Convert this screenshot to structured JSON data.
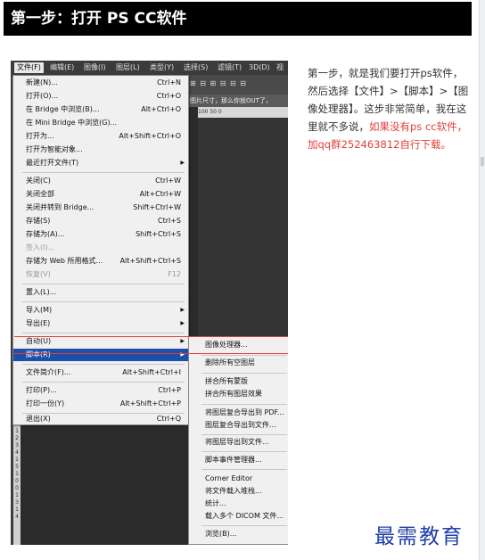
{
  "header": {
    "title": "第一步：打开 PS CC软件"
  },
  "screenshot": {
    "menubar": [
      "文件(F)",
      "编辑(E)",
      "图像(I)",
      "图层(L)",
      "类型(Y)",
      "选择(S)",
      "滤镜(T)",
      "3D(D)",
      "视"
    ],
    "toolbar_icons": "⊞ ⊟ ⊞  ⊟ ⊟ ⊟",
    "doc_title": "图片尺寸，那么你就OUT了，",
    "ruler_top": "100   50    0",
    "ruler_left": "0 1 2 3 4 1 5 1 0 0 1 3 1 4",
    "file_menu": [
      {
        "label": "新建(N)...",
        "shortcut": "Ctrl+N"
      },
      {
        "label": "打开(O)...",
        "shortcut": "Ctrl+O"
      },
      {
        "label": "在 Bridge 中浏览(B)...",
        "shortcut": "Alt+Ctrl+O"
      },
      {
        "label": "在 Mini Bridge 中浏览(G)...",
        "shortcut": ""
      },
      {
        "label": "打开为...",
        "shortcut": "Alt+Shift+Ctrl+O"
      },
      {
        "label": "打开为智能对象...",
        "shortcut": ""
      },
      {
        "label": "最近打开文件(T)",
        "shortcut": ""
      },
      {
        "label": "关闭(C)",
        "shortcut": "Ctrl+W"
      },
      {
        "label": "关闭全部",
        "shortcut": "Alt+Ctrl+W"
      },
      {
        "label": "关闭并转到 Bridge...",
        "shortcut": "Shift+Ctrl+W"
      },
      {
        "label": "存储(S)",
        "shortcut": "Ctrl+S"
      },
      {
        "label": "存储为(A)...",
        "shortcut": "Shift+Ctrl+S"
      },
      {
        "label": "签入(I)...",
        "shortcut": ""
      },
      {
        "label": "存储为 Web 所用格式...",
        "shortcut": "Alt+Shift+Ctrl+S"
      },
      {
        "label": "恢复(V)",
        "shortcut": "F12"
      },
      {
        "label": "置入(L)...",
        "shortcut": ""
      },
      {
        "label": "导入(M)",
        "shortcut": ""
      },
      {
        "label": "导出(E)",
        "shortcut": ""
      },
      {
        "label": "自动(U)",
        "shortcut": ""
      },
      {
        "label": "脚本(R)",
        "shortcut": ""
      },
      {
        "label": "文件简介(F)...",
        "shortcut": "Alt+Shift+Ctrl+I"
      },
      {
        "label": "打印(P)...",
        "shortcut": "Ctrl+P"
      },
      {
        "label": "打印一份(Y)",
        "shortcut": "Alt+Shift+Ctrl+P"
      },
      {
        "label": "退出(X)",
        "shortcut": "Ctrl+Q"
      }
    ],
    "script_submenu": [
      "图像处理器...",
      "删除所有空图层",
      "拼合所有蒙版",
      "拼合所有图层效果",
      "将图层复合导出到 PDF...",
      "图层复合导出到文件...",
      "将图层导出到文件...",
      "脚本事件管理器...",
      "Corner Editor",
      "将文件载入堆栈...",
      "统计...",
      "载入多个 DICOM 文件...",
      "浏览(B)..."
    ]
  },
  "paragraph": {
    "text": "第一步，就是我们要打开ps软件，然后选择【文件】>【脚本】>【图像处理器】。这步非常简单，我在这里就不多说，",
    "highlight": "如果没有ps cc软件，加qq群252463812自行下载。"
  },
  "brand": "最需教育",
  "colors": {
    "header_bg": "#000000",
    "highlight": "#e0403a",
    "brand": "#1f3fa8",
    "menu_highlight": "#1c4fa8"
  }
}
